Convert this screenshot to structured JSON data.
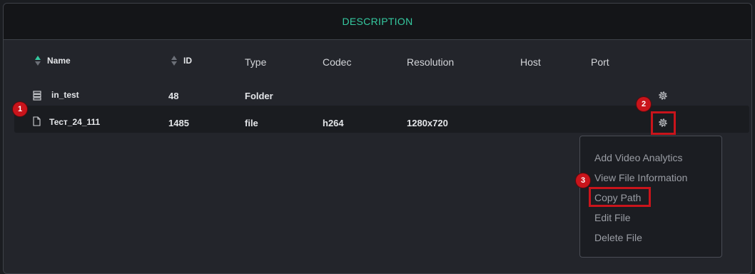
{
  "panel": {
    "title": "DESCRIPTION"
  },
  "table": {
    "headers": {
      "name": "Name",
      "id": "ID",
      "type": "Type",
      "codec": "Codec",
      "resolution": "Resolution",
      "host": "Host",
      "port": "Port"
    },
    "rows": [
      {
        "icon": "folder-stack-icon",
        "name": "in_test",
        "id": "48",
        "type": "Folder",
        "codec": "",
        "resolution": "",
        "host": "",
        "port": ""
      },
      {
        "icon": "file-icon",
        "name": "Тест_24_111",
        "id": "1485",
        "type": "file",
        "codec": "h264",
        "resolution": "1280x720",
        "host": "",
        "port": ""
      }
    ]
  },
  "context_menu": {
    "items": [
      "Add Video Analytics",
      "View File Information",
      "Copy Path",
      "Edit File",
      "Delete File"
    ]
  },
  "markers": [
    "1",
    "2",
    "3"
  ],
  "colors": {
    "accent": "#35c9a0",
    "marker": "#c9141b",
    "background": "#23252b",
    "header": "#141518"
  }
}
